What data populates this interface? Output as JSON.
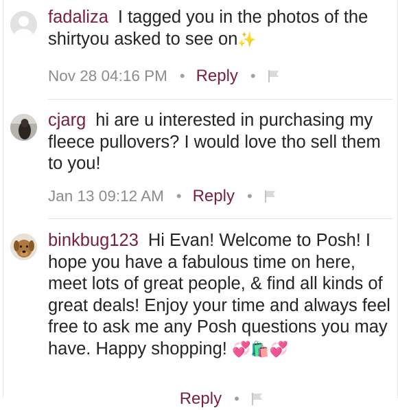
{
  "comments": [
    {
      "username": "fadaliza",
      "message": "I tagged you in the photos of the shirtyou asked to see on",
      "emoji": "✨",
      "timestamp": "Nov 28 04:16 PM",
      "reply_label": "Reply",
      "avatar_icon": "default-user-avatar-icon"
    },
    {
      "username": "cjarg",
      "message": "hi are u interested in purchasing my fleece pullovers? I would love tho sell them to you!",
      "emoji": "",
      "timestamp": "Jan 13 09:12 AM",
      "reply_label": "Reply",
      "avatar_icon": "user-photo-avatar"
    },
    {
      "username": "binkbug123",
      "message": "Hi Evan! Welcome to Posh! I hope you have a fabulous time on here, meet lots of great people, & find all kinds of great deals! Enjoy your time and always feel free to ask me any Posh questions you may have. Happy shopping!",
      "emoji": "💞🛍️💞",
      "timestamp": "",
      "reply_label": "Reply",
      "avatar_icon": "dog-photo-avatar"
    }
  ],
  "colors": {
    "username": "#7a1f3f",
    "meta": "#8b8b8b",
    "body_text": "#242424",
    "separator": "#e3e3e3"
  }
}
